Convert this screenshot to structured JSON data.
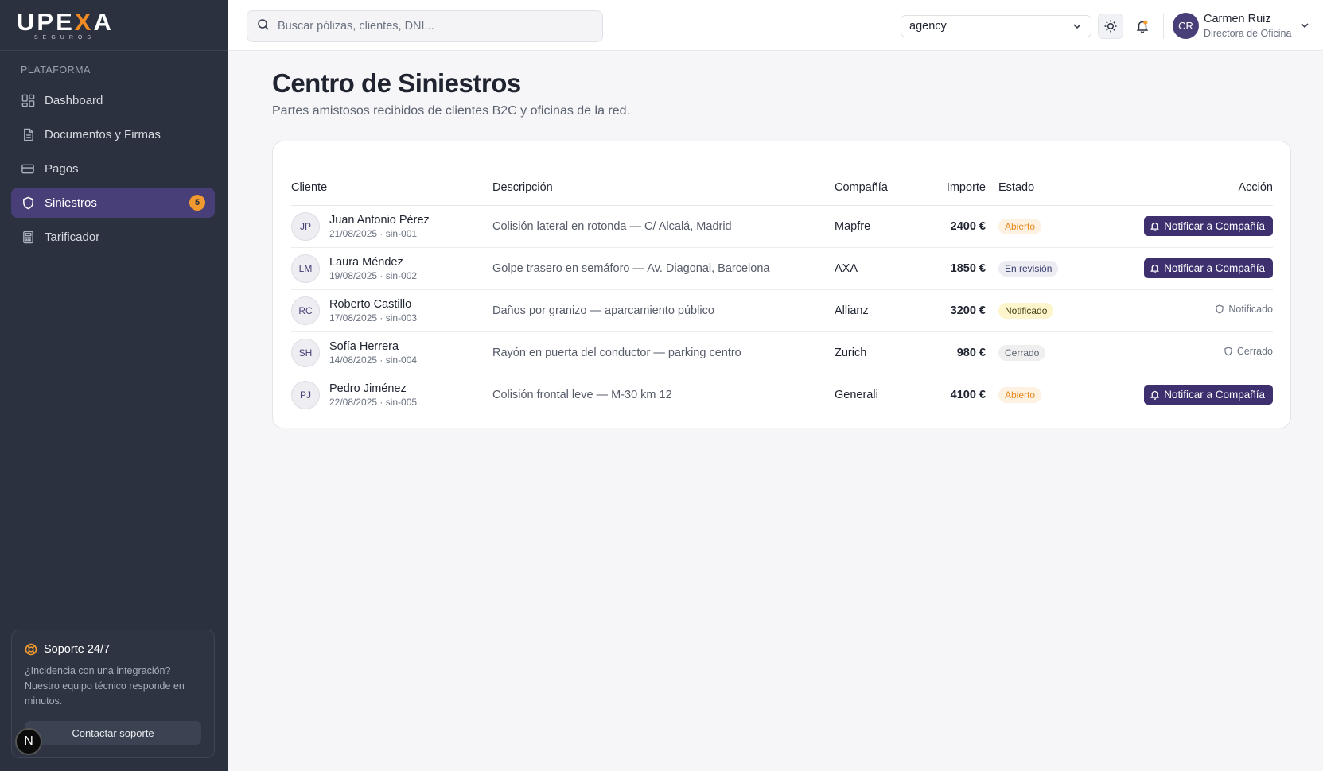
{
  "brand": {
    "logo_main": "UPEXA",
    "logo_prefix": "UPE",
    "logo_x": "X",
    "logo_suffix": "A",
    "logo_sub": "SEGUROS",
    "accent": "#f08a24"
  },
  "sidebar": {
    "section_label": "PLATAFORMA",
    "items": [
      {
        "label": "Dashboard",
        "icon": "grid-icon",
        "active": false
      },
      {
        "label": "Documentos y Firmas",
        "icon": "document-icon",
        "active": false
      },
      {
        "label": "Pagos",
        "icon": "credit-card-icon",
        "active": false
      },
      {
        "label": "Siniestros",
        "icon": "shield-icon",
        "active": true,
        "badge": "5"
      },
      {
        "label": "Tarificador",
        "icon": "calculator-icon",
        "active": false
      }
    ],
    "support": {
      "title": "Soporte 24/7",
      "text": "¿Incidencia con una integración? Nuestro equipo técnico responde en minutos.",
      "button": "Contactar soporte"
    },
    "floating_badge": "N"
  },
  "topbar": {
    "search_placeholder": "Buscar pólizas, clientes, DNI...",
    "select_value": "agency",
    "user": {
      "initials": "CR",
      "name": "Carmen Ruiz",
      "role": "Directora de Oficina"
    }
  },
  "page": {
    "title": "Centro de Siniestros",
    "subtitle": "Partes amistosos recibidos de clientes B2C y oficinas de la red."
  },
  "table": {
    "columns": {
      "client": "Cliente",
      "description": "Descripción",
      "company": "Compañía",
      "amount": "Importe",
      "status": "Estado",
      "action": "Acción"
    },
    "rows": [
      {
        "initials": "JP",
        "name": "Juan Antonio Pérez",
        "meta": "21/08/2025 · sin-001",
        "description": "Colisión lateral en rotonda — C/ Alcalá, Madrid",
        "company": "Mapfre",
        "amount": "2400 €",
        "status": "Abierto",
        "action": "Notificar a Compañía"
      },
      {
        "initials": "LM",
        "name": "Laura Méndez",
        "meta": "19/08/2025 · sin-002",
        "description": "Golpe trasero en semáforo — Av. Diagonal, Barcelona",
        "company": "AXA",
        "amount": "1850 €",
        "status": "En revisión",
        "action": "Notificar a Compañía"
      },
      {
        "initials": "RC",
        "name": "Roberto Castillo",
        "meta": "17/08/2025 · sin-003",
        "description": "Daños por granizo — aparcamiento público",
        "company": "Allianz",
        "amount": "3200 €",
        "status": "Notificado",
        "action": "Notificado"
      },
      {
        "initials": "SH",
        "name": "Sofía Herrera",
        "meta": "14/08/2025 · sin-004",
        "description": "Rayón en puerta del conductor — parking centro",
        "company": "Zurich",
        "amount": "980 €",
        "status": "Cerrado",
        "action": "Cerrado"
      },
      {
        "initials": "PJ",
        "name": "Pedro Jiménez",
        "meta": "22/08/2025 · sin-005",
        "description": "Colisión frontal leve — M-30 km 12",
        "company": "Generali",
        "amount": "4100 €",
        "status": "Abierto",
        "action": "Notificar a Compañía"
      }
    ]
  }
}
